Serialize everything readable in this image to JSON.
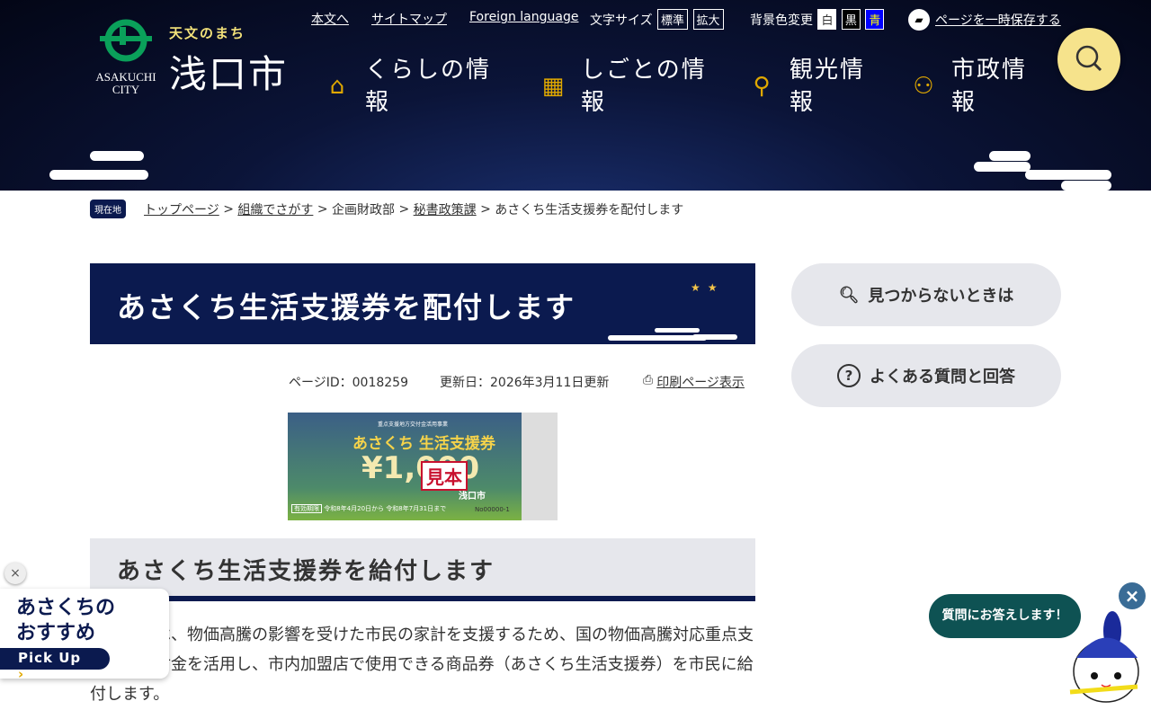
{
  "header": {
    "logo": {
      "city_en_1": "ASAKUCHI",
      "city_en_2": "CITY",
      "tagline": "天文のまち",
      "name": "浅口市"
    },
    "util_links": [
      "本文へ",
      "サイトマップ",
      "Foreign language"
    ],
    "font_size": {
      "label": "文字サイズ",
      "options": [
        "標準",
        "拡大"
      ]
    },
    "bg_color": {
      "label": "背景色変更",
      "options": [
        "白",
        "黒",
        "青"
      ]
    },
    "save_page": "ページを一時保存する",
    "nav": [
      {
        "label": "くらしの情報",
        "icon": "house-icon"
      },
      {
        "label": "しごとの情報",
        "icon": "building-icon"
      },
      {
        "label": "観光情報",
        "icon": "map-pin-icon"
      },
      {
        "label": "市政情報",
        "icon": "people-icon"
      }
    ],
    "search_icon": "search-icon"
  },
  "breadcrumb": {
    "here": "現在地",
    "items": [
      "トップページ",
      "組織でさがす",
      "企画財政部",
      "秘書政策課",
      "あさくち生活支援券を配付します"
    ],
    "sep": ">"
  },
  "page": {
    "title": "あさくち生活支援券を配付します",
    "page_id": "ページID：0018259",
    "updated": "更新日：2026年3月11日更新",
    "print": "印刷ページ表示",
    "ticket": {
      "top": "重点支援地方交付金活用事業",
      "name": "あさくち 生活支援券",
      "amount": "¥1,000",
      "sample": "見本",
      "validity_label": "有効期限",
      "validity": "令和8年4月20日から 令和8年7月31日まで",
      "serial": "No00000-1",
      "issuer": "浅口市"
    },
    "heading": "あさくち生活支援券を給付します",
    "body": "浅口市では、物価高騰の影響を受けた市民の家計を支援するため、国の物価高騰対応重点支援地方交付金を活用し、市内加盟店で使用できる商品券（あさくち生活支援券）を市民に給付します。"
  },
  "sidebar": {
    "not_found": "見つからないときは",
    "faq": "よくある質問と回答"
  },
  "pickup": {
    "line1": "あさくちの",
    "line2": "おすすめ",
    "button": "Pick Up",
    "close": "×"
  },
  "chatbot": {
    "bubble": "質問にお答えします！",
    "close": "×"
  },
  "colors": {
    "navy": "#0b1a4f",
    "search_bg": "#f6e38c",
    "chat": "#0e5253",
    "accent_icon": "#e0a800"
  }
}
